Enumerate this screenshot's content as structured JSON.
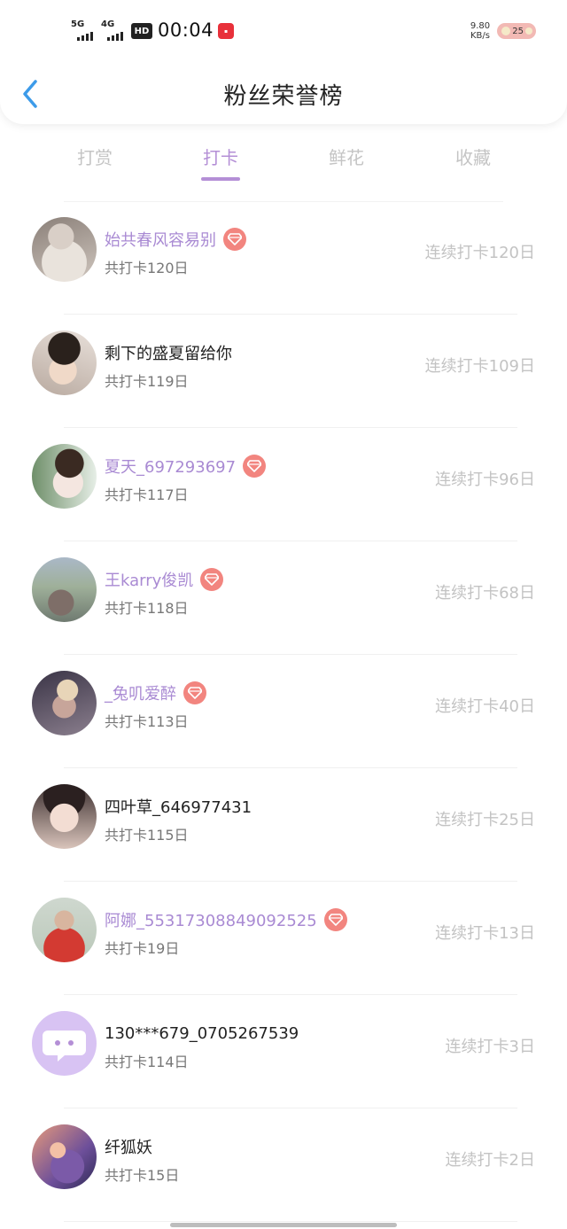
{
  "status_bar": {
    "net1": "5G",
    "net2": "4G",
    "hd_label": "HD",
    "time": "00:04",
    "speed_value": "9.80",
    "speed_unit": "KB/s",
    "battery": "25"
  },
  "header": {
    "title": "粉丝荣誉榜"
  },
  "tabs": [
    {
      "label": "打赏",
      "active": false
    },
    {
      "label": "打卡",
      "active": true
    },
    {
      "label": "鲜花",
      "active": false
    },
    {
      "label": "收藏",
      "active": false
    }
  ],
  "colors": {
    "accent": "#b48fd6",
    "vip_name": "#a98ad3",
    "diamond_badge": "#f2857f",
    "muted": "#c3c3c3",
    "back_arrow": "#3d9be9"
  },
  "rows": [
    {
      "name": "始共春风容易别",
      "vip": true,
      "total": "共打卡120日",
      "streak": "连续打卡120日"
    },
    {
      "name": "剩下的盛夏留给你",
      "vip": false,
      "total": "共打卡119日",
      "streak": "连续打卡109日"
    },
    {
      "name": "夏天_697293697",
      "vip": true,
      "total": "共打卡117日",
      "streak": "连续打卡96日"
    },
    {
      "name": "王karry俊凯",
      "vip": true,
      "total": "共打卡118日",
      "streak": "连续打卡68日"
    },
    {
      "name": "_兔叽爱醉",
      "vip": true,
      "total": "共打卡113日",
      "streak": "连续打卡40日"
    },
    {
      "name": "四叶草_646977431",
      "vip": false,
      "total": "共打卡115日",
      "streak": "连续打卡25日"
    },
    {
      "name": "阿娜_55317308849092525",
      "vip": true,
      "total": "共打卡19日",
      "streak": "连续打卡13日"
    },
    {
      "name": "130***679_0705267539",
      "vip": false,
      "total": "共打卡114日",
      "streak": "连续打卡3日"
    },
    {
      "name": "纤狐妖",
      "vip": false,
      "total": "共打卡15日",
      "streak": "连续打卡2日"
    }
  ]
}
